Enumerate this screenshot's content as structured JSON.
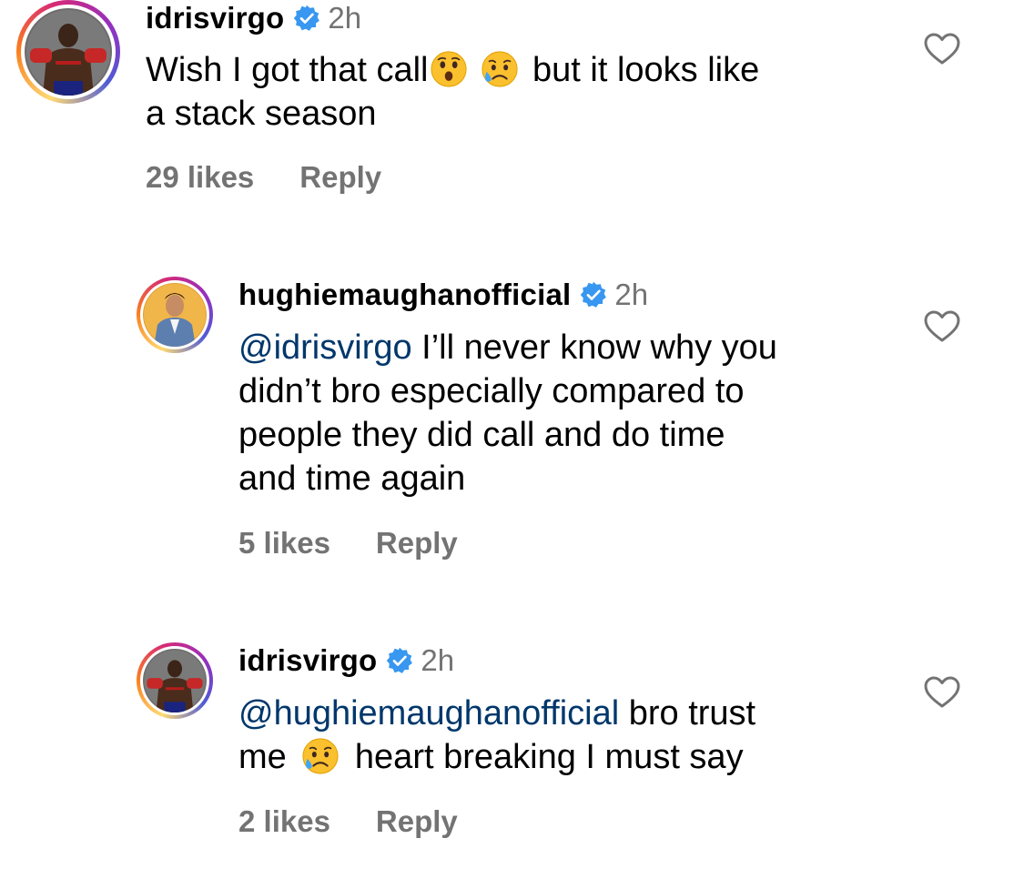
{
  "comments": [
    {
      "username": "idrisvirgo",
      "time": "2h",
      "text_part1": "Wish I got that call",
      "text_part2": " but it looks like",
      "text_line2": "a stack season",
      "emojis": [
        "hushed-face-emoji",
        "sad-relieved-face-emoji"
      ],
      "likes": "29 likes",
      "reply_label": "Reply"
    },
    {
      "username": "hughiemaughanofficial",
      "time": "2h",
      "mention": "@idrisvirgo",
      "text_line1": " I’ll never know why you",
      "text_line2": "didn’t bro especially compared to",
      "text_line3": "people they did call and do time",
      "text_line4": "and time again",
      "likes": "5 likes",
      "reply_label": "Reply"
    },
    {
      "username": "idrisvirgo",
      "time": "2h",
      "mention": "@hughiemaughanofficial",
      "text_line1": " bro trust",
      "text_line2a": "me ",
      "text_line2b": " heart breaking I must say",
      "emojis": [
        "sad-relieved-face-emoji"
      ],
      "likes": "2 likes",
      "reply_label": "Reply"
    }
  ],
  "colors": {
    "verified": "#3897f0",
    "mention": "#00376b",
    "secondary_text": "#737373"
  },
  "icons": [
    "verified-badge-icon",
    "heart-outline-icon"
  ]
}
